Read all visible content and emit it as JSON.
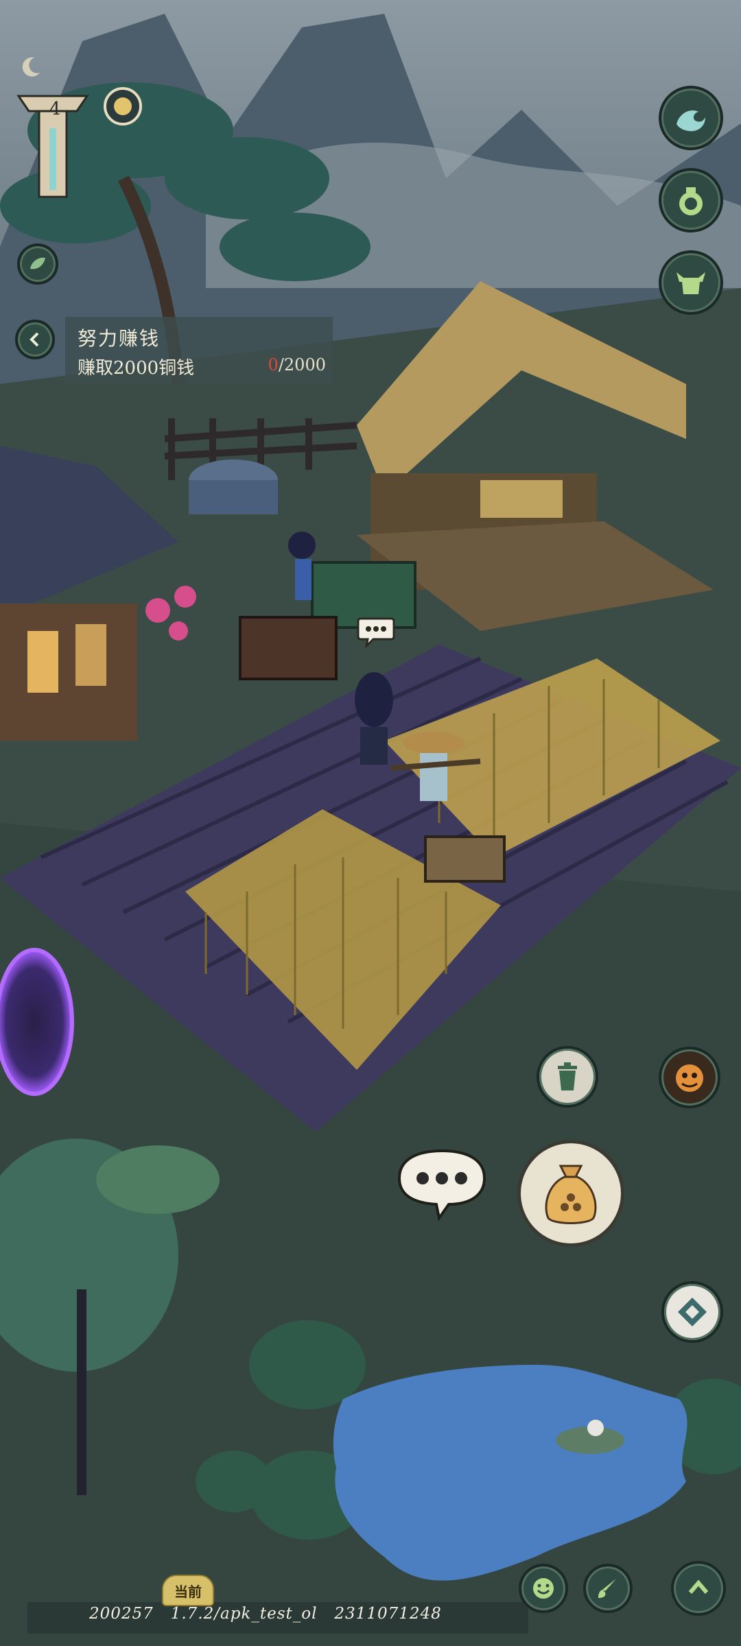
{
  "hud": {
    "day": "4",
    "moon_icon": "crescent-moon-icon",
    "sun_icon": "sun-disc-icon"
  },
  "quest": {
    "title": "努力赚钱",
    "description": "赚取2000铜钱",
    "progress_current": "0",
    "progress_total": "/2000"
  },
  "right_buttons": [
    "wave-icon",
    "pot-icon",
    "ox-icon"
  ],
  "actions": {
    "trash_icon": "trash-icon",
    "lion_icon": "lion-dance-icon",
    "chat_icon": "speech-bubble-icon",
    "seed_bag_icon": "seed-bag-icon",
    "diamond_icon": "diamond-compass-icon",
    "emoji_icon": "smile-icon",
    "brush_icon": "brush-icon",
    "up_icon": "chevron-up-icon"
  },
  "footer": {
    "badge": "当前",
    "version": "200257   1.7.2/apk_test_ol   2311071248"
  },
  "colors": {
    "quest_progress_red": "#e0463b",
    "hud_green": "#2f4a43",
    "badge_gold": "#d6c06a"
  }
}
